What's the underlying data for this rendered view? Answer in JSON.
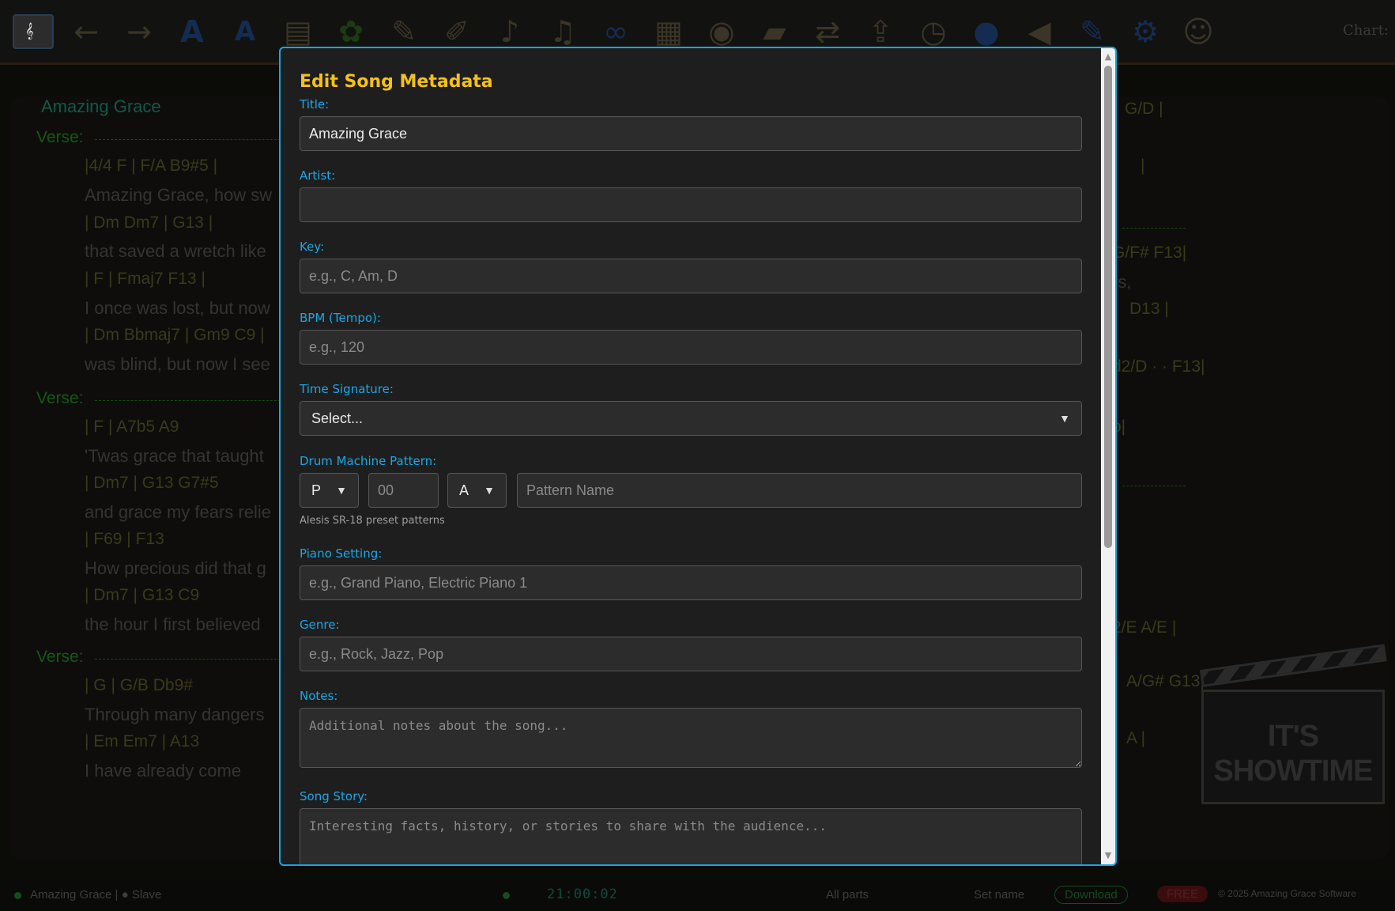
{
  "toolbar": {
    "icons": [
      "home-icon",
      "back-arrow-icon",
      "forward-arrow-icon",
      "font-large-icon",
      "font-small-icon",
      "document-icon",
      "plant-icon",
      "notepad-icon",
      "pen-icon",
      "treble-clef-icon",
      "trumpet-icon",
      "bb-trumpet-icon",
      "meta-icon",
      "keyboard-icon",
      "chrome-icon",
      "clapper-icon",
      "swap-icon",
      "upload-icon",
      "alarm-clock-icon",
      "chat-icon",
      "mute-icon",
      "edit-icon",
      "settings-icon",
      "performer-icon"
    ],
    "chart_label": "Chart:"
  },
  "background": {
    "song_title": "Amazing Grace",
    "sections": [
      "Verse:",
      "Verse:",
      "Verse:"
    ],
    "left_lines": [
      {
        "kind": "chord",
        "text": "|4/4  F      |  F/A  B9#5 |"
      },
      {
        "kind": "lyric",
        "text": "Amazing Grace, how sw"
      },
      {
        "kind": "chord",
        "text": "| Dm  Dm7 |    G13    |"
      },
      {
        "kind": "lyric",
        "text": "that saved a wretch like"
      },
      {
        "kind": "chord",
        "text": "|      F      | Fmaj7  F13  |"
      },
      {
        "kind": "lyric",
        "text": "I once was lost, but now"
      },
      {
        "kind": "chord",
        "text": "| Dm  Bbmaj7 | Gm9  C9 |"
      },
      {
        "kind": "lyric",
        "text": "was blind, but now I see"
      },
      {
        "kind": "chord",
        "text": "|      F      | A7b5   A9"
      },
      {
        "kind": "lyric",
        "text": "'Twas grace that taught"
      },
      {
        "kind": "chord",
        "text": "|    Dm7    |  G13  G7#5"
      },
      {
        "kind": "lyric",
        "text": "and grace my fears relie"
      },
      {
        "kind": "chord",
        "text": "|     F69     |     F13"
      },
      {
        "kind": "lyric",
        "text": "How precious did that g"
      },
      {
        "kind": "chord",
        "text": "|     Dm7    |   G13  C9"
      },
      {
        "kind": "lyric",
        "text": "the hour I first believed"
      },
      {
        "kind": "chord",
        "text": "|     G      |  G/B  Db9#"
      },
      {
        "kind": "lyric",
        "text": "Through many dangers"
      },
      {
        "kind": "chord",
        "text": "| Em  Em7 |      A13"
      },
      {
        "kind": "lyric",
        "text": "I have already come"
      }
    ],
    "right_fragments": [
      "G/D  |",
      "|",
      "G/F#  F13|",
      "rs,",
      "D13    |",
      "d2/D ·  ·  F13|",
      "b|",
      "2/E  A/E  |",
      "A/G#  G13|",
      "A    |"
    ],
    "watermark": "IT'S SHOWTIME"
  },
  "statusbar": {
    "song": "Amazing Grace | ● Slave",
    "clock": "21:00:02",
    "parts": "All parts",
    "set_name": "Set name",
    "download": "Download",
    "free": "FREE",
    "copyright": "© 2025 Amazing Grace Software"
  },
  "modal": {
    "title": "Edit Song Metadata",
    "fields": {
      "title": {
        "label": "Title:",
        "value": "Amazing Grace",
        "placeholder": ""
      },
      "artist": {
        "label": "Artist:",
        "value": "",
        "placeholder": ""
      },
      "key": {
        "label": "Key:",
        "value": "",
        "placeholder": "e.g., C, Am, D"
      },
      "bpm": {
        "label": "BPM (Tempo):",
        "value": "",
        "placeholder": "e.g., 120"
      },
      "time_signature": {
        "label": "Time Signature:",
        "selected": "Select..."
      },
      "drum": {
        "label": "Drum Machine Pattern:",
        "bank_selected": "P",
        "number_placeholder": "00",
        "variant_selected": "A",
        "name_placeholder": "Pattern Name",
        "hint": "Alesis SR-18 preset patterns"
      },
      "piano": {
        "label": "Piano Setting:",
        "value": "",
        "placeholder": "e.g., Grand Piano, Electric Piano 1"
      },
      "genre": {
        "label": "Genre:",
        "value": "",
        "placeholder": "e.g., Rock, Jazz, Pop"
      },
      "notes": {
        "label": "Notes:",
        "placeholder": "Additional notes about the song..."
      },
      "story": {
        "label": "Song Story:",
        "placeholder": "Interesting facts, history, or stories to share with the audience..."
      }
    },
    "colors": {
      "accent": "#11a8e0",
      "title": "#f5c118",
      "label": "#18a7e8",
      "background": "#1e1e1e"
    }
  }
}
